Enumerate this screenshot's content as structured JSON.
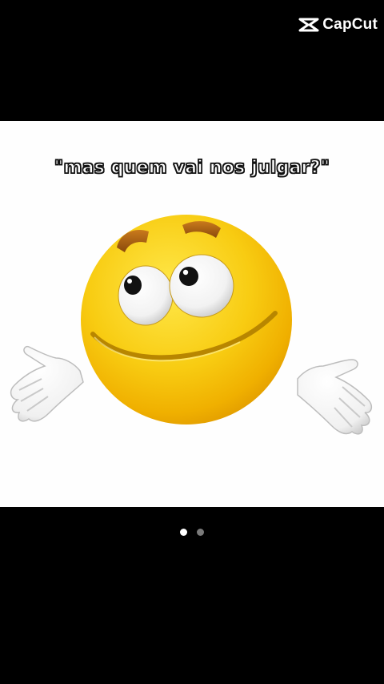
{
  "watermark": {
    "brand": "CapCut",
    "icon": "capcut-logo-icon"
  },
  "media": {
    "caption": "\"mas quem vai nos julgar?\"",
    "image": "shrugging-emoji"
  },
  "pager": {
    "count": 2,
    "active_index": 0,
    "icon": "pagination-dot"
  },
  "colors": {
    "background": "#000000",
    "media_background": "#fefefe",
    "emoji_yellow": "#f5c400",
    "dot_active": "#ffffff",
    "dot_inactive": "#7a7a7a"
  }
}
